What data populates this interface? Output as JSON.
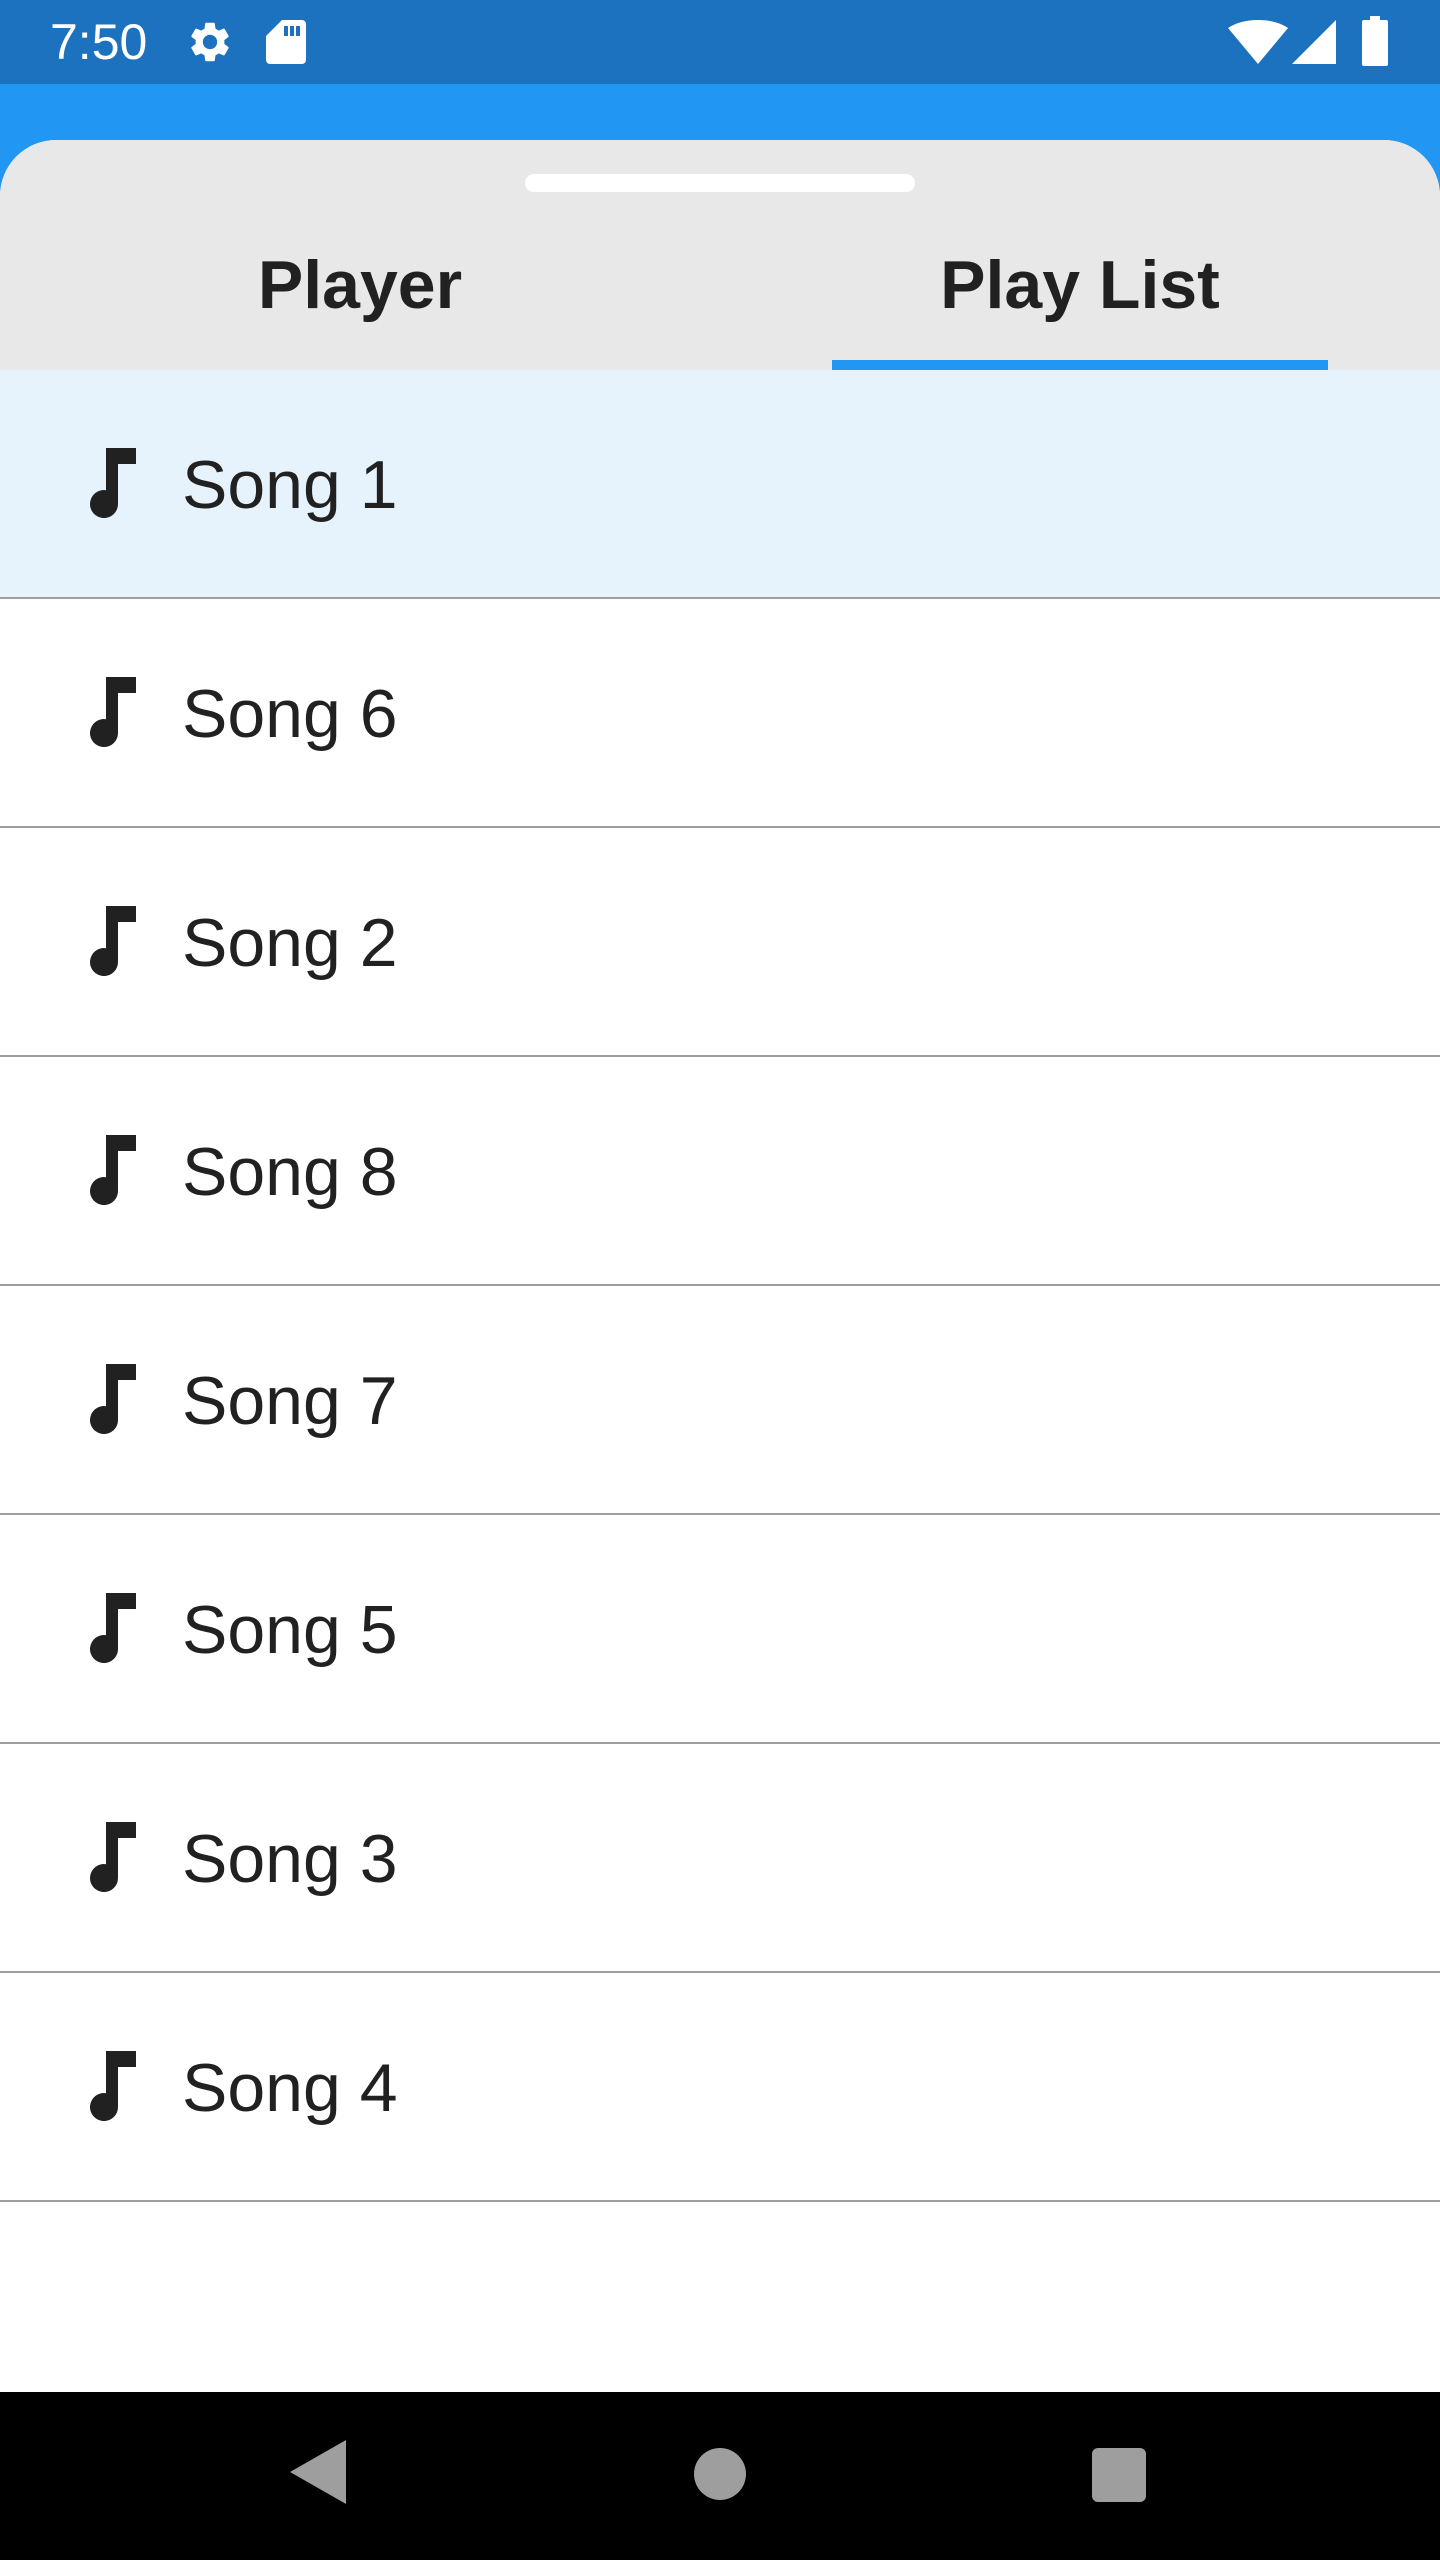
{
  "status_bar": {
    "time": "7:50",
    "icons": [
      "gear-icon",
      "sd-card-icon",
      "wifi-icon",
      "cell-signal-icon",
      "battery-icon"
    ]
  },
  "tabs": [
    {
      "label": "Player",
      "selected": false
    },
    {
      "label": "Play List",
      "selected": true
    }
  ],
  "colors": {
    "accent": "#2196f3",
    "status_bar": "#1c72be",
    "tab_header_bg": "#e8e8e8",
    "selected_row_bg": "#e6f3fd"
  },
  "playlist": {
    "items": [
      {
        "title": "Song 1",
        "icon": "music-note-icon",
        "selected": true
      },
      {
        "title": "Song 6",
        "icon": "music-note-icon",
        "selected": false
      },
      {
        "title": "Song 2",
        "icon": "music-note-icon",
        "selected": false
      },
      {
        "title": "Song 8",
        "icon": "music-note-icon",
        "selected": false
      },
      {
        "title": "Song 7",
        "icon": "music-note-icon",
        "selected": false
      },
      {
        "title": "Song 5",
        "icon": "music-note-icon",
        "selected": false
      },
      {
        "title": "Song 3",
        "icon": "music-note-icon",
        "selected": false
      },
      {
        "title": "Song 4",
        "icon": "music-note-icon",
        "selected": false
      }
    ]
  },
  "nav_bar": {
    "buttons": [
      "back-icon",
      "home-icon",
      "recents-icon"
    ]
  }
}
